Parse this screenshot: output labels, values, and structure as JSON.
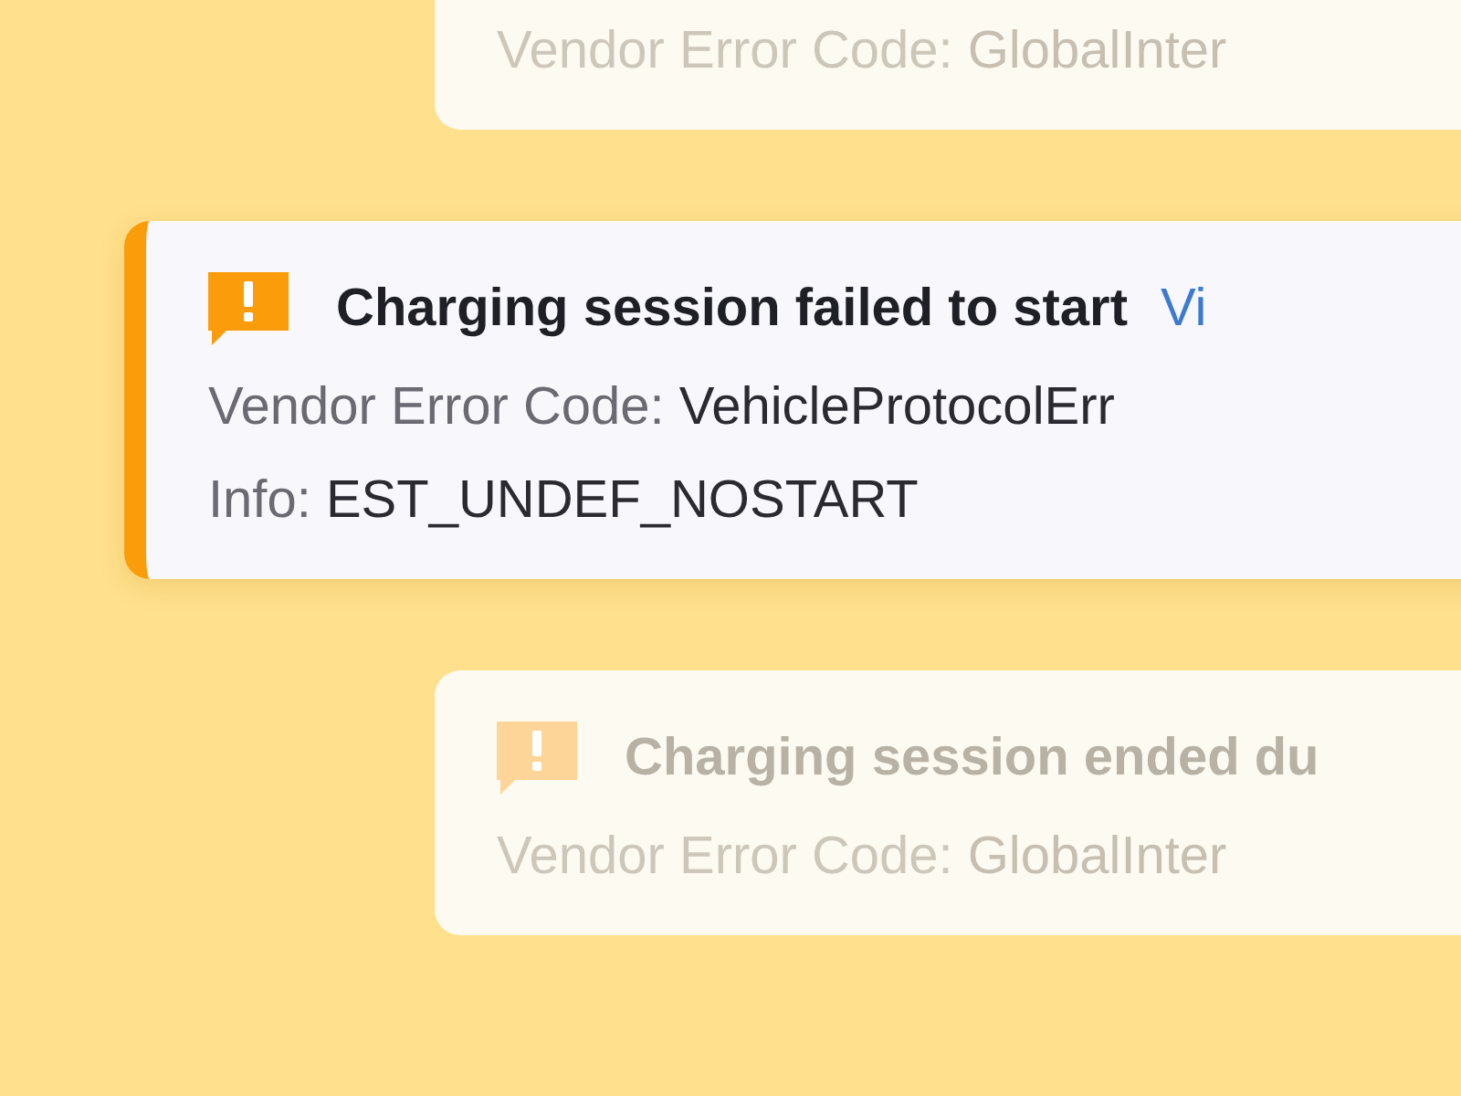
{
  "alerts": [
    {
      "selected": false,
      "vendor_label": "Vendor Error Code:",
      "vendor_value": "GlobalInter"
    },
    {
      "selected": true,
      "title": "Charging session failed to start",
      "link": "Vi",
      "vendor_label": "Vendor Error Code:",
      "vendor_value": "VehicleProtocolErr",
      "info_label": "Info:",
      "info_value": "EST_UNDEF_NOSTART"
    },
    {
      "selected": false,
      "title": "Charging session ended du",
      "vendor_label": "Vendor Error Code:",
      "vendor_value": "GlobalInter"
    }
  ]
}
